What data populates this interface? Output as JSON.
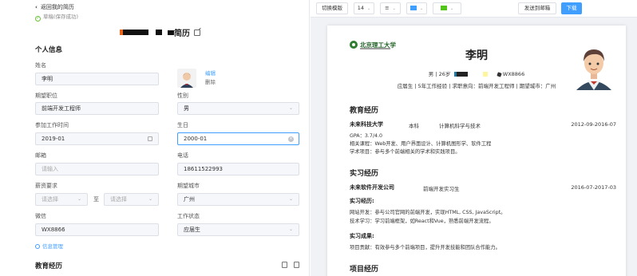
{
  "header": {
    "back_label": "返回我的简历",
    "saved_label": "草稿(保存成功)",
    "title_suffix": "简历"
  },
  "form": {
    "section_personal": "个人信息",
    "name_label": "姓名",
    "name_value": "李明",
    "avatar_edit": "编辑",
    "avatar_delete": "删除",
    "job_label": "期望职位",
    "job_value": "前端开发工程师",
    "gender_label": "性别",
    "gender_value": "男",
    "work_start_label": "参加工作时间",
    "work_start_value": "2019-01",
    "birthday_label": "生日",
    "birthday_value": "2000-01",
    "email_label": "邮箱",
    "email_placeholder": "请输入",
    "phone_label": "电话",
    "phone_value": "18611522993",
    "salary_label": "薪资要求",
    "salary_min_placeholder": "请选择",
    "salary_to": "至",
    "salary_max_placeholder": "请选择",
    "city_label": "期望城市",
    "city_value": "广州",
    "wechat_label": "微信",
    "wechat_value": "WX8866",
    "status_label": "工作状态",
    "status_value": "应届生",
    "info_manage": "信息管理",
    "section_education": "教育经历"
  },
  "toolbar": {
    "switch_template": "切换模版",
    "font_size": "14",
    "send_email": "发送到邮箱",
    "download": "下载",
    "accent_color": "#52c41a",
    "layout_color": "#409eff"
  },
  "preview": {
    "school_logo_text": "北京理工大学",
    "name": "李明",
    "gender": "男",
    "age": "26岁",
    "wechat": "WX8866",
    "line2": "应届生 | 5年工作经验 | 求职意向：前端开发工程师 | 期望城市：广州",
    "edu_title": "教育经历",
    "edu_school": "未来科技大学",
    "edu_degree": "本科",
    "edu_major": "计算机科学与技术",
    "edu_date": "2012-09-2016-07",
    "edu_gpa": "GPA：3.7/4.0",
    "edu_courses": "相关课程：Web开发、用户界面设计、计算机图形学、软件工程",
    "edu_projects": "学术项目：参与多个前端相关的学术和实践项目。",
    "intern_title": "实习经历",
    "intern_company": "未来软件开发公司",
    "intern_role": "前端开发实习生",
    "intern_date": "2016-07-2017-03",
    "intern_sub1": "实习经历:",
    "intern_text1": "网站开发：参与公司官网的前端开发，实现HTML, CSS, JavaScript。",
    "intern_text2": "技术学习：学习前端框架，如React和Vue，熟悉前端开发流程。",
    "intern_sub2": "实习成果:",
    "intern_text3": "项目贡献：有效参与多个前端项目，提升开发技能和团队合作能力。",
    "project_title": "项目经历"
  }
}
